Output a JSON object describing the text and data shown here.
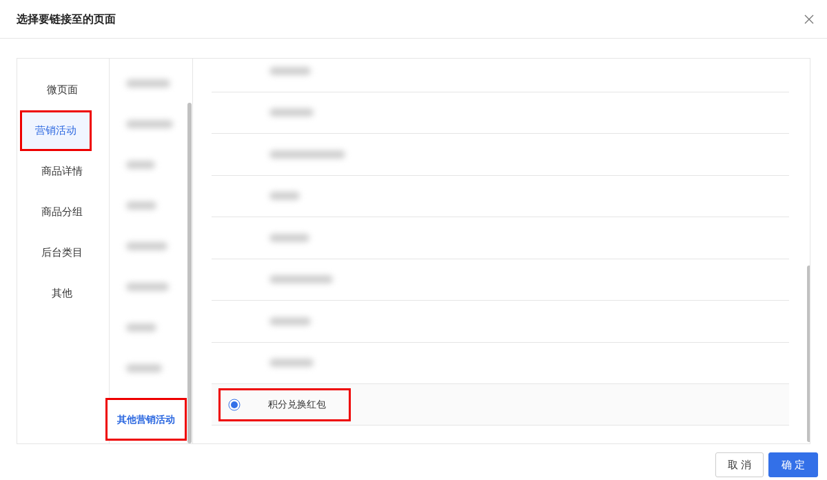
{
  "dialog": {
    "title": "选择要链接至的页面"
  },
  "categories": [
    {
      "label": "微页面",
      "selected": false,
      "highlighted": false
    },
    {
      "label": "营销活动",
      "selected": true,
      "highlighted": true
    },
    {
      "label": "商品详情",
      "selected": false,
      "highlighted": false
    },
    {
      "label": "商品分组",
      "selected": false,
      "highlighted": false
    },
    {
      "label": "后台类目",
      "selected": false,
      "highlighted": false
    },
    {
      "label": "其他",
      "selected": false,
      "highlighted": false
    }
  ],
  "subcategories": [
    {
      "kind": "blurred"
    },
    {
      "kind": "blurred"
    },
    {
      "kind": "blurred"
    },
    {
      "kind": "blurred"
    },
    {
      "kind": "blurred"
    },
    {
      "kind": "blurred"
    },
    {
      "kind": "blurred"
    },
    {
      "kind": "blurred"
    },
    {
      "kind": "item",
      "label": "其他营销活动",
      "selected": true,
      "highlighted": true
    }
  ],
  "options": [
    {
      "kind": "blurred"
    },
    {
      "kind": "blurred"
    },
    {
      "kind": "blurred"
    },
    {
      "kind": "blurred"
    },
    {
      "kind": "blurred"
    },
    {
      "kind": "blurred"
    },
    {
      "kind": "blurred"
    },
    {
      "kind": "blurred"
    },
    {
      "kind": "item",
      "label": "积分兑换红包",
      "selected": true,
      "highlighted": true
    }
  ],
  "buttons": [
    {
      "label": "取 消",
      "kind": "secondary"
    },
    {
      "label": "确 定",
      "kind": "primary"
    }
  ]
}
